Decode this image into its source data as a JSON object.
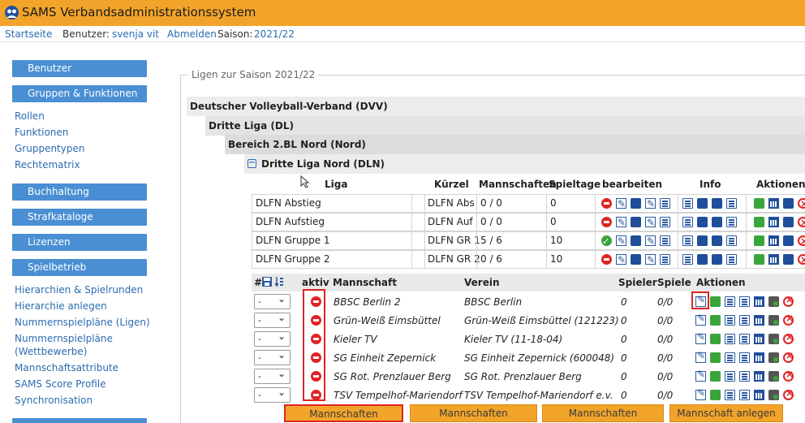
{
  "app": {
    "title": "SAMS Verbandsadministrationssystem"
  },
  "nav": {
    "home": "Startseite",
    "user_label": "Benutzer:",
    "user_name": "svenja vit",
    "logout": "Abmelden",
    "season_label": "Saison:",
    "season": "2021/22"
  },
  "sidebar": {
    "btn_users": "Benutzer",
    "btn_groups": "Gruppen & Funktionen",
    "groups_links": [
      "Rollen",
      "Funktionen",
      "Gruppentypen",
      "Rechtematrix"
    ],
    "btn_accounting": "Buchhaltung",
    "btn_penalties": "Strafkataloge",
    "btn_licenses": "Lizenzen",
    "btn_games": "Spielbetrieb",
    "games_links": [
      "Hierarchien & Spielrunden",
      "Hierarchie anlegen",
      "Nummernspielpläne (Ligen)",
      "Nummernspielpläne",
      "(Wettbewerbe)",
      "Mannschaftsattribute",
      "SAMS Score Profile",
      "Synchronisation"
    ]
  },
  "main": {
    "legend": "Ligen zur Saison 2021/22",
    "hierarchy": {
      "level1": "Deutscher Volleyball-Verband (DVV)",
      "level2": "Dritte Liga (DL)",
      "level3": "Bereich 2.BL Nord (Nord)",
      "level4": "Dritte Liga Nord (DLN)"
    },
    "league_table": {
      "headers": {
        "liga": "Liga",
        "kuerzel": "Kürzel",
        "mannschaften": "Mannschaften",
        "spieltage": "Spieltage",
        "bearbeiten": "bearbeiten",
        "info": "Info",
        "aktionen": "Aktionen"
      },
      "rows": [
        {
          "liga": "DLFN Abstieg",
          "kuerzel": "DLFN Abs",
          "mannschaften": "0 / 0",
          "spieltage": "0",
          "status": "inactive"
        },
        {
          "liga": "DLFN Aufstieg",
          "kuerzel": "DLFN Auf",
          "mannschaften": "0 / 0",
          "spieltage": "0",
          "status": "inactive"
        },
        {
          "liga": "DLFN Gruppe 1",
          "kuerzel": "DLFN GR 1",
          "mannschaften": "5 / 6",
          "spieltage": "10",
          "status": "active"
        },
        {
          "liga": "DLFN Gruppe 2",
          "kuerzel": "DLFN GR 2",
          "mannschaften": "0 / 6",
          "spieltage": "10",
          "status": "inactive"
        }
      ]
    },
    "team_table": {
      "headers": {
        "num": "#",
        "aktiv": "aktiv",
        "mannschaft": "Mannschaft",
        "verein": "Verein",
        "spieler": "Spieler",
        "spiele": "Spiele",
        "aktionen": "Aktionen"
      },
      "rows": [
        {
          "select": "-",
          "mannschaft": "BBSC Berlin 2",
          "verein": "BBSC Berlin",
          "spieler": "0",
          "spiele": "0/0"
        },
        {
          "select": "-",
          "mannschaft": "Grün-Weiß Eimsbüttel",
          "verein": "Grün-Weiß Eimsbüttel (121223)",
          "spieler": "0",
          "spiele": "0/0"
        },
        {
          "select": "-",
          "mannschaft": "Kieler TV",
          "verein": "Kieler TV (11-18-04)",
          "spieler": "0",
          "spiele": "0/0"
        },
        {
          "select": "-",
          "mannschaft": "SG Einheit Zepernick",
          "verein": "SG Einheit Zepernick (600048)",
          "spieler": "0",
          "spiele": "0/0"
        },
        {
          "select": "-",
          "mannschaft": "SG Rot. Prenzlauer Berg",
          "verein": "SG Rot. Prenzlauer Berg",
          "spieler": "0",
          "spiele": "0/0"
        },
        {
          "select": "-",
          "mannschaft": "TSV Tempelhof-Mariendorf",
          "verein": "TSV Tempelhof-Mariendorf e.v.",
          "spieler": "0",
          "spiele": "0/0"
        }
      ]
    },
    "buttons": {
      "activate": "Mannschaften aktivieren",
      "deactivate": "Mannschaften deaktivieren",
      "move": "Mannschaften verschieben",
      "create": "Mannschaft anlegen"
    }
  }
}
